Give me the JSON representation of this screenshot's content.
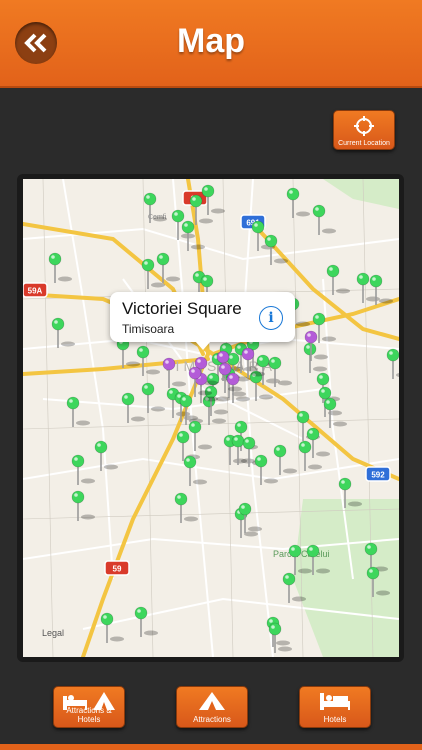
{
  "header": {
    "title": "Map",
    "back_icon": "double-chevron-left-icon"
  },
  "current_location": {
    "label": "Current Location",
    "icon": "crosshair-icon"
  },
  "map": {
    "city_label": "TIMISOARA",
    "park_label": "Parcul Carelui",
    "street_label": "Cemfi",
    "road_shields": [
      "69",
      "691",
      "59A",
      "592",
      "59"
    ],
    "legal": "Legal",
    "callout": {
      "title": "Victoriei Square",
      "subtitle": "Timisoara",
      "info_icon": "info-icon"
    }
  },
  "bottom_tabs": [
    {
      "label": "Attractions & Hotels",
      "icon": "bed-and-tent-icon"
    },
    {
      "label": "Attractions",
      "icon": "tent-icon"
    },
    {
      "label": "Hotels",
      "icon": "bed-icon"
    }
  ],
  "colors": {
    "accent": "#e86a1e",
    "pin_green": "#3dd65c",
    "pin_purple": "#b45cd8"
  }
}
